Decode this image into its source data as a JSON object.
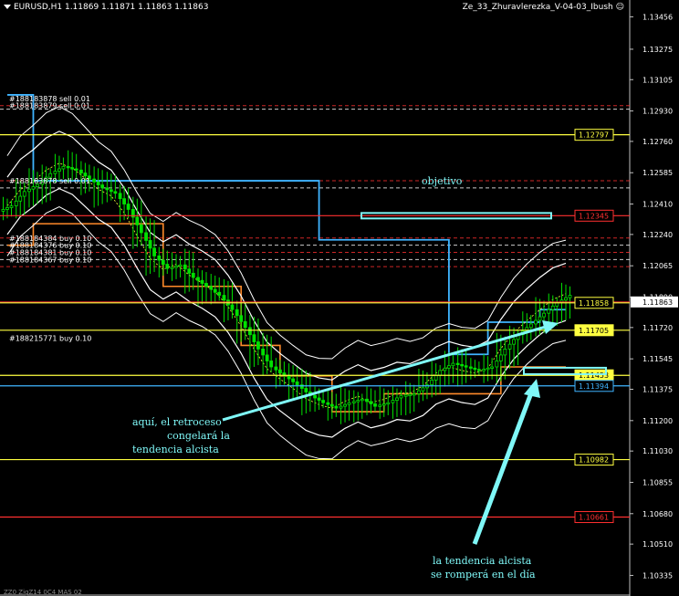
{
  "header": {
    "symbol_info": "EURUSD,H1  1.11869 1.11871 1.11863 1.11863",
    "indicator_name": "Ze_33_Zhuravlerezka_V-04-03_Ibush"
  },
  "colors": {
    "background": "#000000",
    "candle": "#00e000",
    "bollinger": "#ffffff",
    "channel_blue": "#3fb4ff",
    "channel_orange": "#ff8a2a",
    "support_yellow": "#ffff40",
    "resistance_red": "#ff3030",
    "annotation_cyan": "#7ff8f8",
    "current_price_box": "#ff3030"
  },
  "chart_data": {
    "type": "candlestick",
    "symbol": "EURUSD",
    "timeframe": "H1",
    "ylim": [
      1.1022,
      1.1355
    ],
    "y_ticks": [
      "1.13456",
      "1.13275",
      "1.13105",
      "1.12930",
      "1.12760",
      "1.12585",
      "1.12410",
      "1.12240",
      "1.12065",
      "1.11890",
      "1.11720",
      "1.11545",
      "1.11375",
      "1.11200",
      "1.11030",
      "1.10855",
      "1.10680",
      "1.10510",
      "1.10335"
    ],
    "close_path": [
      1.124,
      1.1248,
      1.1252,
      1.1258,
      1.1262,
      1.126,
      1.1255,
      1.125,
      1.1247,
      1.1238,
      1.1225,
      1.1212,
      1.1205,
      1.1207,
      1.12,
      1.1195,
      1.119,
      1.1182,
      1.1172,
      1.116,
      1.115,
      1.1145,
      1.114,
      1.1134,
      1.113,
      1.1127,
      1.113,
      1.1132,
      1.1128,
      1.113,
      1.1134,
      1.1135,
      1.114,
      1.1148,
      1.1152,
      1.115,
      1.1148,
      1.115,
      1.116,
      1.1168,
      1.1174,
      1.118,
      1.1186,
      1.119
    ],
    "price_levels": [
      {
        "label": "1.12797",
        "value": 1.12797,
        "color": "#ffff40",
        "style": "solid"
      },
      {
        "label": "1.12345",
        "value": 1.12345,
        "color": "#ff3030",
        "style": "solid"
      },
      {
        "label": "1.11863",
        "value": 1.11863,
        "color": "#ff3030",
        "style": "current"
      },
      {
        "label": "1.11858",
        "value": 1.11858,
        "color": "#ffff40",
        "style": "solid"
      },
      {
        "label": "1.11705",
        "value": 1.11705,
        "color": "#ffff40",
        "style": "solid"
      },
      {
        "label": "1.11453",
        "value": 1.11453,
        "color": "#ffff40",
        "style": "solid"
      },
      {
        "label": "1.11394",
        "value": 1.11394,
        "color": "#3fb4ff",
        "style": "solid"
      },
      {
        "label": "1.10982",
        "value": 1.10982,
        "color": "#ffff40",
        "style": "solid"
      },
      {
        "label": "1.10661",
        "value": 1.10661,
        "color": "#ff3030",
        "style": "solid"
      }
    ],
    "dashed_levels": [
      1.1296,
      1.1294,
      1.1254,
      1.125,
      1.1222,
      1.1218,
      1.1214,
      1.121,
      1.1206
    ],
    "order_labels": [
      {
        "text": "#188183878 sell 0.01",
        "y": 1.13
      },
      {
        "text": "#188183879 sell 0.01",
        "y": 1.1296
      },
      {
        "text": "#188183878 sell 0.01",
        "y": 1.1254
      },
      {
        "text": "#188184384 buy 0.10",
        "y": 1.1222
      },
      {
        "text": "#188184376 buy 0.10",
        "y": 1.1218
      },
      {
        "text": "#188184381 buy 0.10",
        "y": 1.1214
      },
      {
        "text": "#188184367 buy 0.10",
        "y": 1.121
      },
      {
        "text": "#188215771 buy 0.10",
        "y": 1.1166
      }
    ],
    "annotations": {
      "target": "objetivo",
      "retracement": [
        "aquí, el retroceso",
        "congelará la",
        "tendencia alcista"
      ],
      "breakdown": [
        "la tendencia alcista",
        "se romperá en el día"
      ]
    },
    "bottom_text": "ZZ0 ZigZ14 0C4 MAS 02"
  }
}
